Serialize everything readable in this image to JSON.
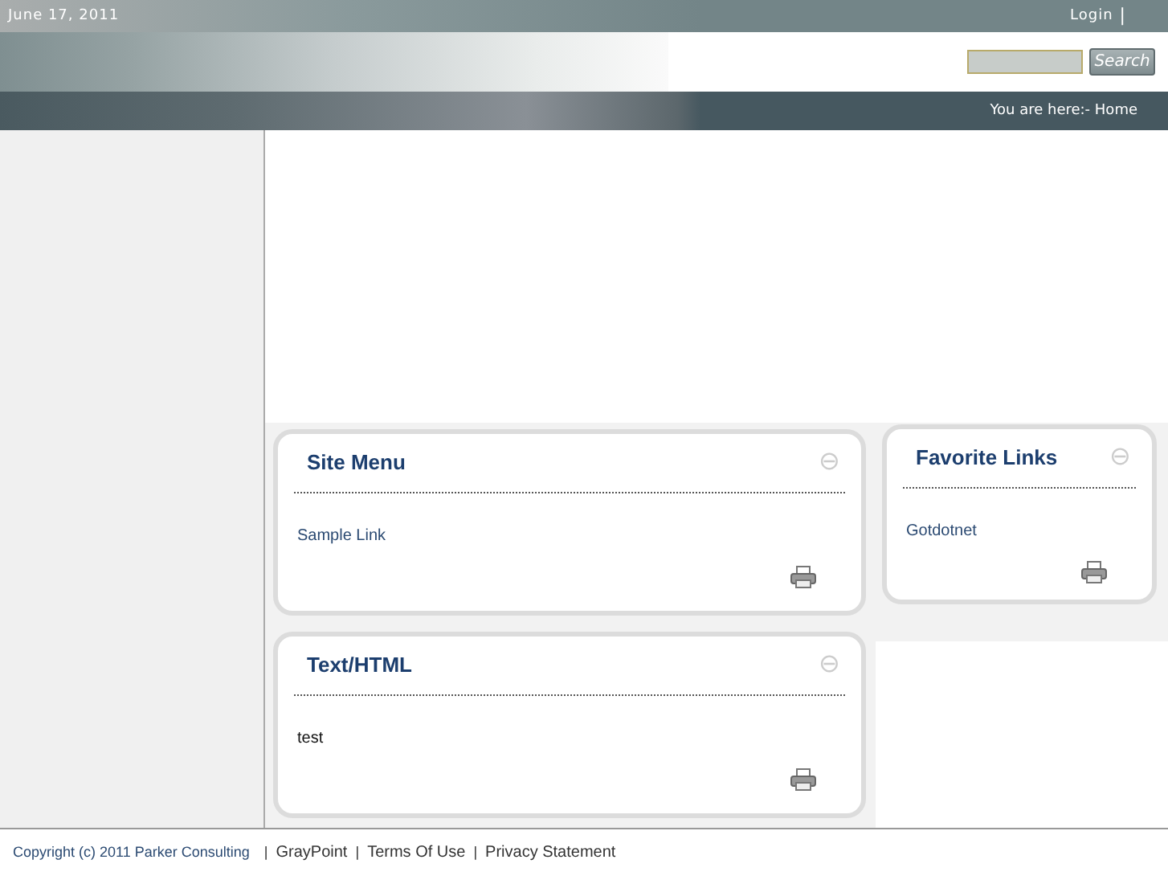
{
  "top_bar": {
    "date": "June 17, 2011",
    "login": "Login",
    "separator": "|"
  },
  "search": {
    "button": "Search"
  },
  "breadcrumb": "You are here:- Home",
  "panes": [
    {
      "modules": [
        {
          "title": "Site Menu",
          "collapse": "⊖",
          "body": {
            "kind": "link",
            "text": "Sample Link"
          }
        },
        {
          "title": "Text/HTML",
          "collapse": "⊖",
          "body": {
            "kind": "text",
            "text": "test"
          }
        }
      ]
    },
    {
      "modules": [
        {
          "title": "Favorite Links",
          "collapse": "⊖",
          "body": {
            "kind": "link",
            "text": "Gotdotnet"
          }
        }
      ]
    }
  ],
  "footer": {
    "copyright": "Copyright (c) 2011 Parker Consulting",
    "links": [
      "GrayPoint",
      "Terms Of Use",
      "Privacy Statement"
    ],
    "separator": "|"
  }
}
